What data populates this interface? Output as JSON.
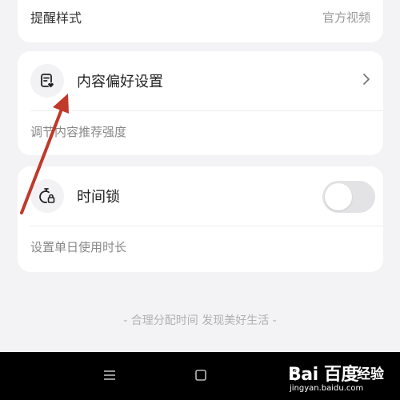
{
  "reminder_row": {
    "label": "提醒样式",
    "value": "官方视频"
  },
  "content_pref": {
    "icon": "doc-heart-icon",
    "title": "内容偏好设置",
    "subtitle": "调节内容推荐强度"
  },
  "time_lock": {
    "icon": "stopwatch-lock-icon",
    "title": "时间锁",
    "subtitle": "设置单日使用时长",
    "enabled": false
  },
  "footer": {
    "slogan": "- 合理分配时间 发现美好生活 -"
  },
  "navbar": {
    "menu_icon": "menu-icon",
    "home_icon": "square-home-icon",
    "back_icon": "back-chevron-icon"
  },
  "watermark": {
    "brand": "Bai 百度",
    "suffix": "经验",
    "url": "jingyan.baidu.com"
  },
  "colors": {
    "background": "#f3f3f5",
    "card": "#ffffff",
    "arrow": "#c0392b",
    "toggle_off": "#e3e3e5",
    "navbar": "#000000"
  }
}
